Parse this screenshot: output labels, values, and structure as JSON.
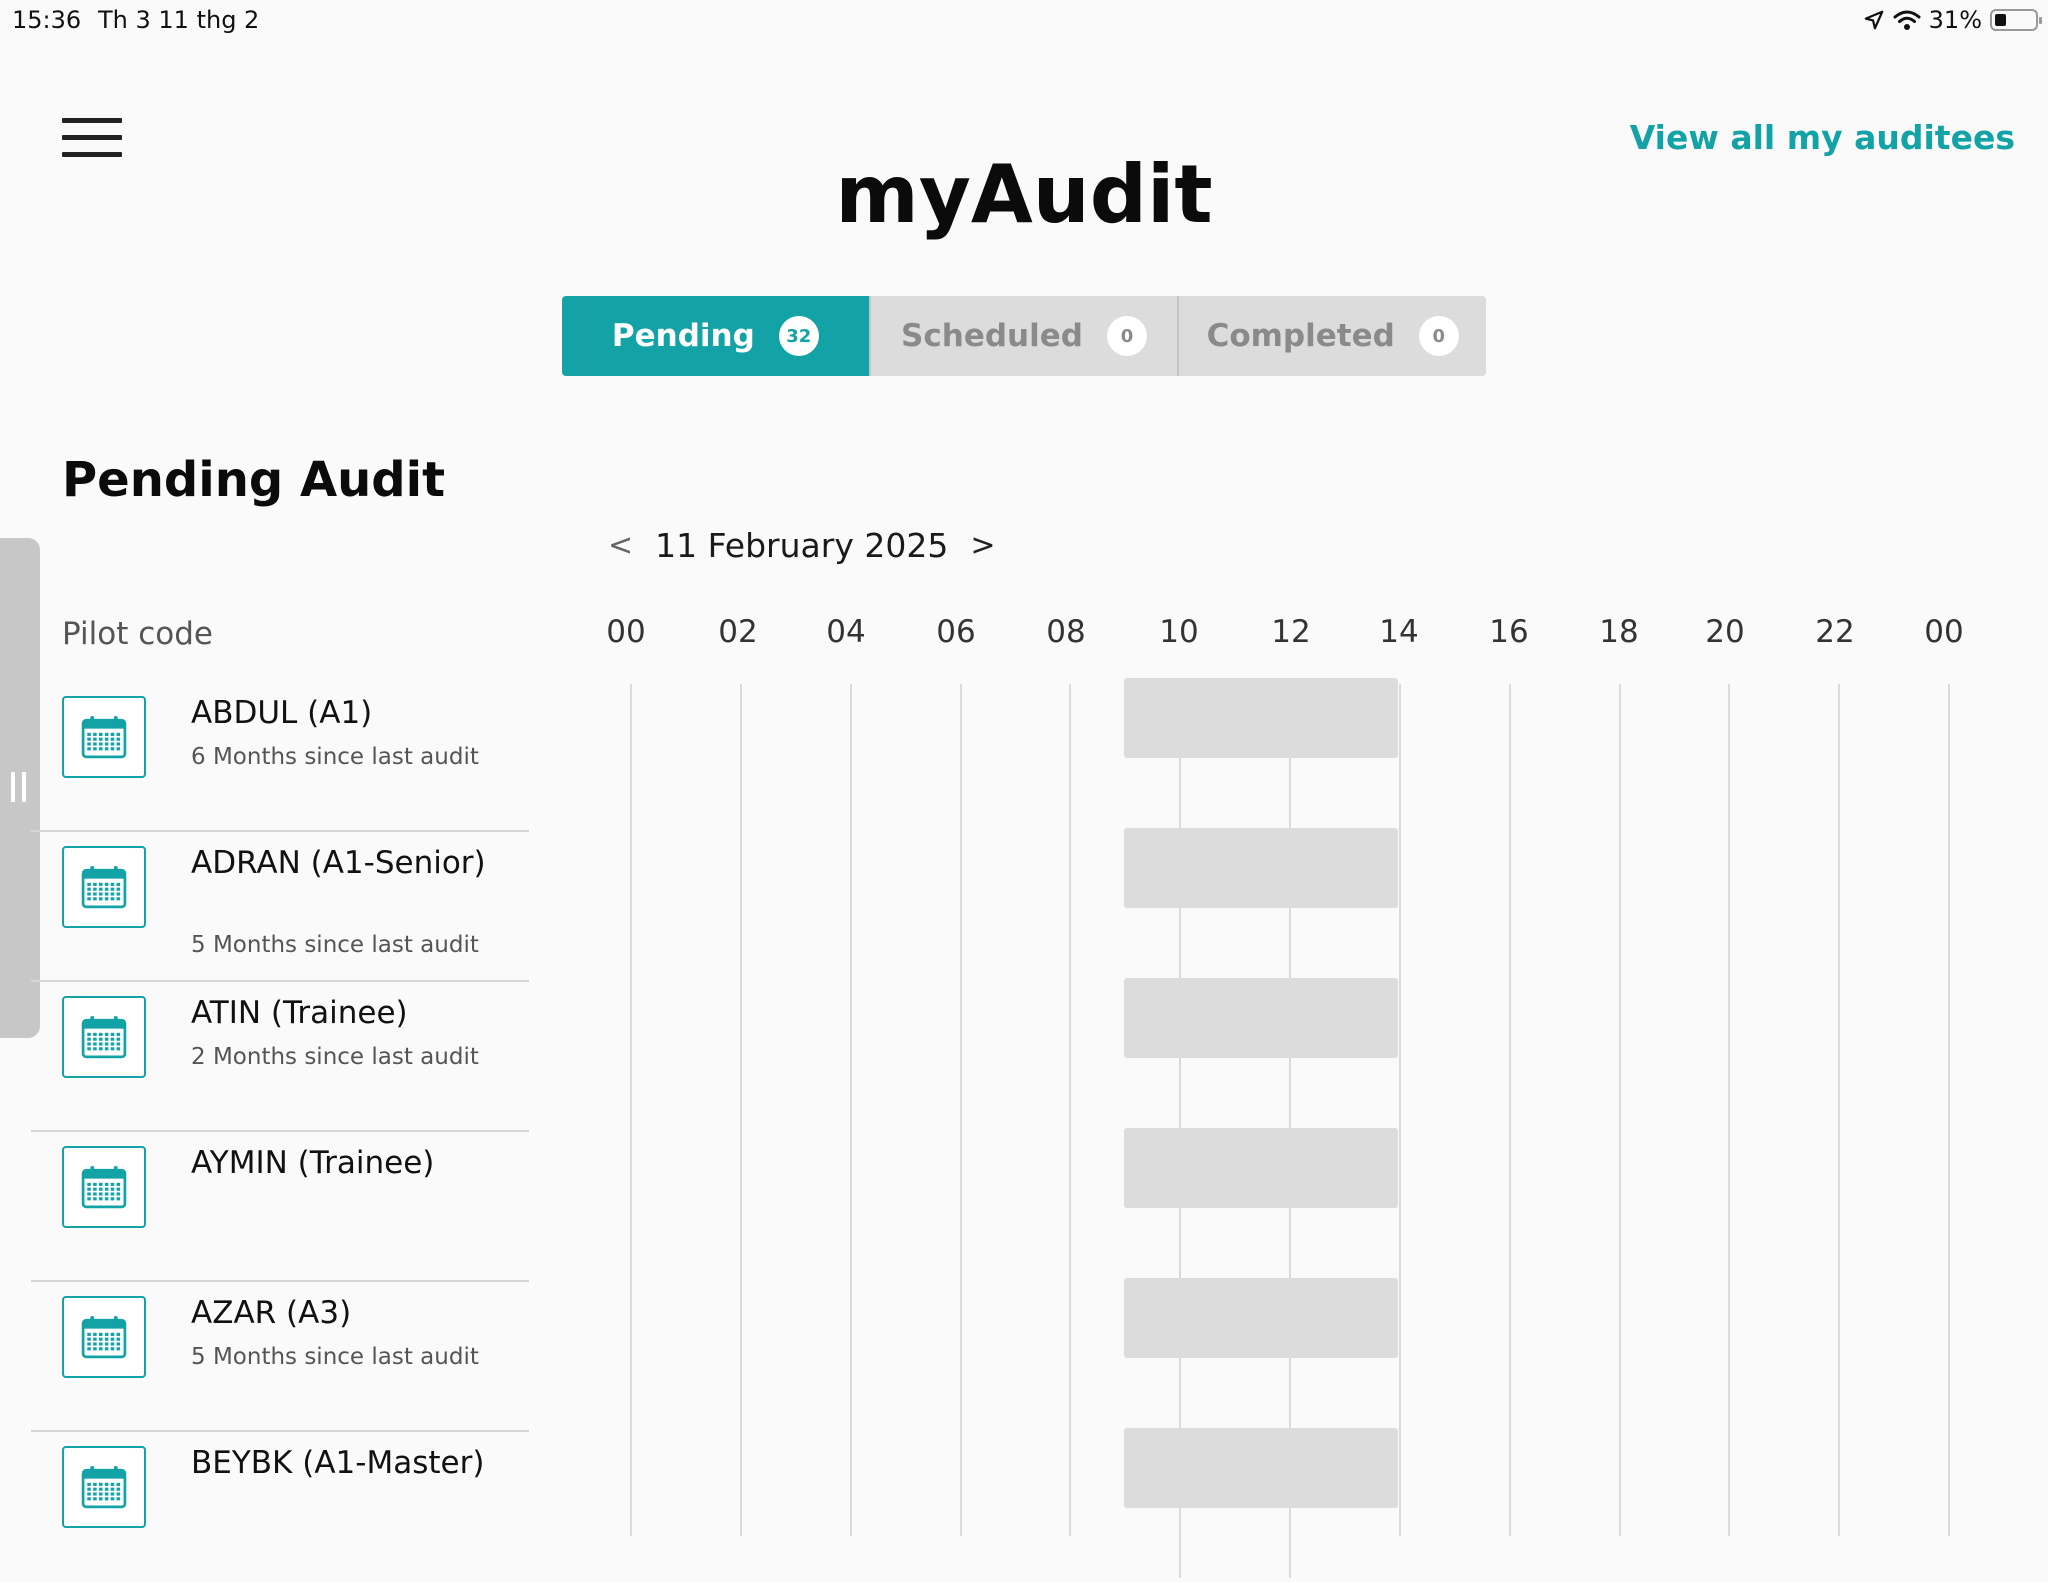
{
  "status_bar": {
    "time": "15:36",
    "date": "Th 3 11 thg 2",
    "battery": "31%"
  },
  "header": {
    "title": "myAudit",
    "view_all_link": "View all my auditees"
  },
  "tabs": [
    {
      "label": "Pending",
      "count": "32",
      "active": true
    },
    {
      "label": "Scheduled",
      "count": "0",
      "active": false
    },
    {
      "label": "Completed",
      "count": "0",
      "active": false
    }
  ],
  "section": {
    "title": "Pending Audit",
    "column_header": "Pilot code"
  },
  "date_nav": {
    "prev": "<",
    "date": "11 February 2025",
    "next": ">"
  },
  "timeline": {
    "hours": [
      "00",
      "02",
      "04",
      "06",
      "08",
      "10",
      "12",
      "14",
      "16",
      "18",
      "20",
      "22",
      "00"
    ]
  },
  "pilots": [
    {
      "name": "ABDUL (A1)",
      "subtitle": "6 Months since last audit"
    },
    {
      "name": "ADRAN (A1-Senior)",
      "subtitle": "5 Months since last audit"
    },
    {
      "name": "ATIN (Trainee)",
      "subtitle": "2 Months since last audit"
    },
    {
      "name": "AYMIN (Trainee)",
      "subtitle": ""
    },
    {
      "name": "AZAR (A3)",
      "subtitle": "5 Months since last audit"
    },
    {
      "name": "BEYBK (A1-Master)",
      "subtitle": ""
    }
  ],
  "colors": {
    "accent": "#13a3a6",
    "slot": "#dcdcdc",
    "tab_inactive": "#dcdcdc"
  },
  "icons": {
    "menu": "hamburger-menu-icon",
    "calendar": "calendar-icon",
    "location": "location-arrow-icon",
    "wifi": "wifi-icon",
    "battery": "battery-icon"
  }
}
